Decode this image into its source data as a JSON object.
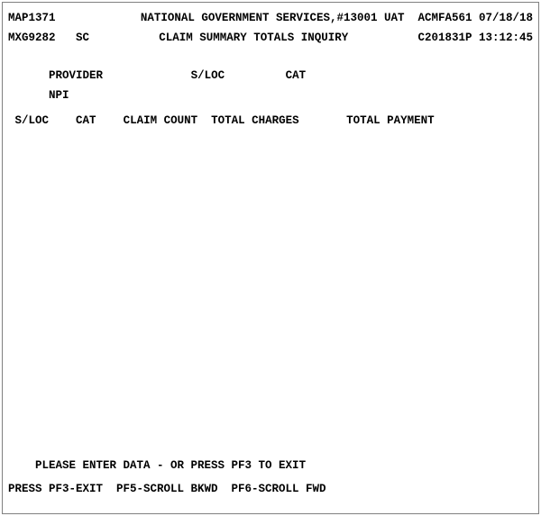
{
  "header": {
    "screen_id": "MAP1371",
    "system_right": "NATIONAL GOVERNMENT SERVICES,#13001 UAT  ACMFA561 07/18/18",
    "session": "MXG9282",
    "mode": "SC",
    "title": "CLAIM SUMMARY TOTALS INQUIRY",
    "cycle_time": "C201831P 13:12:45"
  },
  "filters": {
    "provider": "PROVIDER",
    "sloc": "S/LOC",
    "cat": "CAT",
    "npi": "NPI"
  },
  "columns": {
    "sloc": "S/LOC",
    "cat": "CAT",
    "claim_count": "CLAIM COUNT",
    "total_charges": "TOTAL CHARGES",
    "total_payment": "TOTAL PAYMENT"
  },
  "footer": {
    "prompt": "PLEASE ENTER DATA - OR PRESS PF3 TO EXIT",
    "keys": "PRESS PF3-EXIT  PF5-SCROLL BKWD  PF6-SCROLL FWD"
  }
}
